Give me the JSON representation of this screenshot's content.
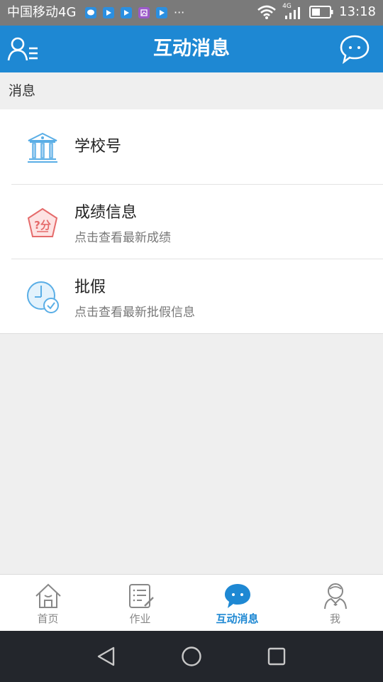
{
  "status_bar": {
    "carrier": "中国移动4G",
    "more": "···",
    "network_badge": "4G",
    "time": "13:18"
  },
  "app_bar": {
    "title": "互动消息"
  },
  "section": {
    "header": "消息"
  },
  "list": {
    "items": [
      {
        "title": "学校号",
        "subtitle": "",
        "icon": "school-building-icon"
      },
      {
        "title": "成绩信息",
        "subtitle": "点击查看最新成绩",
        "icon": "score-badge-icon"
      },
      {
        "title": "批假",
        "subtitle": "点击查看最新批假信息",
        "icon": "leave-clock-icon"
      }
    ]
  },
  "tab_bar": {
    "tabs": [
      {
        "label": "首页",
        "icon": "home-icon",
        "active": false
      },
      {
        "label": "作业",
        "icon": "homework-icon",
        "active": false
      },
      {
        "label": "互动消息",
        "icon": "chat-bubble-icon",
        "active": true
      },
      {
        "label": "我",
        "icon": "profile-icon",
        "active": false
      }
    ]
  },
  "colors": {
    "primary": "#1e88d3",
    "status_bar": "#7a7a7a",
    "nav_bar": "#23262c",
    "background": "#efefef"
  }
}
